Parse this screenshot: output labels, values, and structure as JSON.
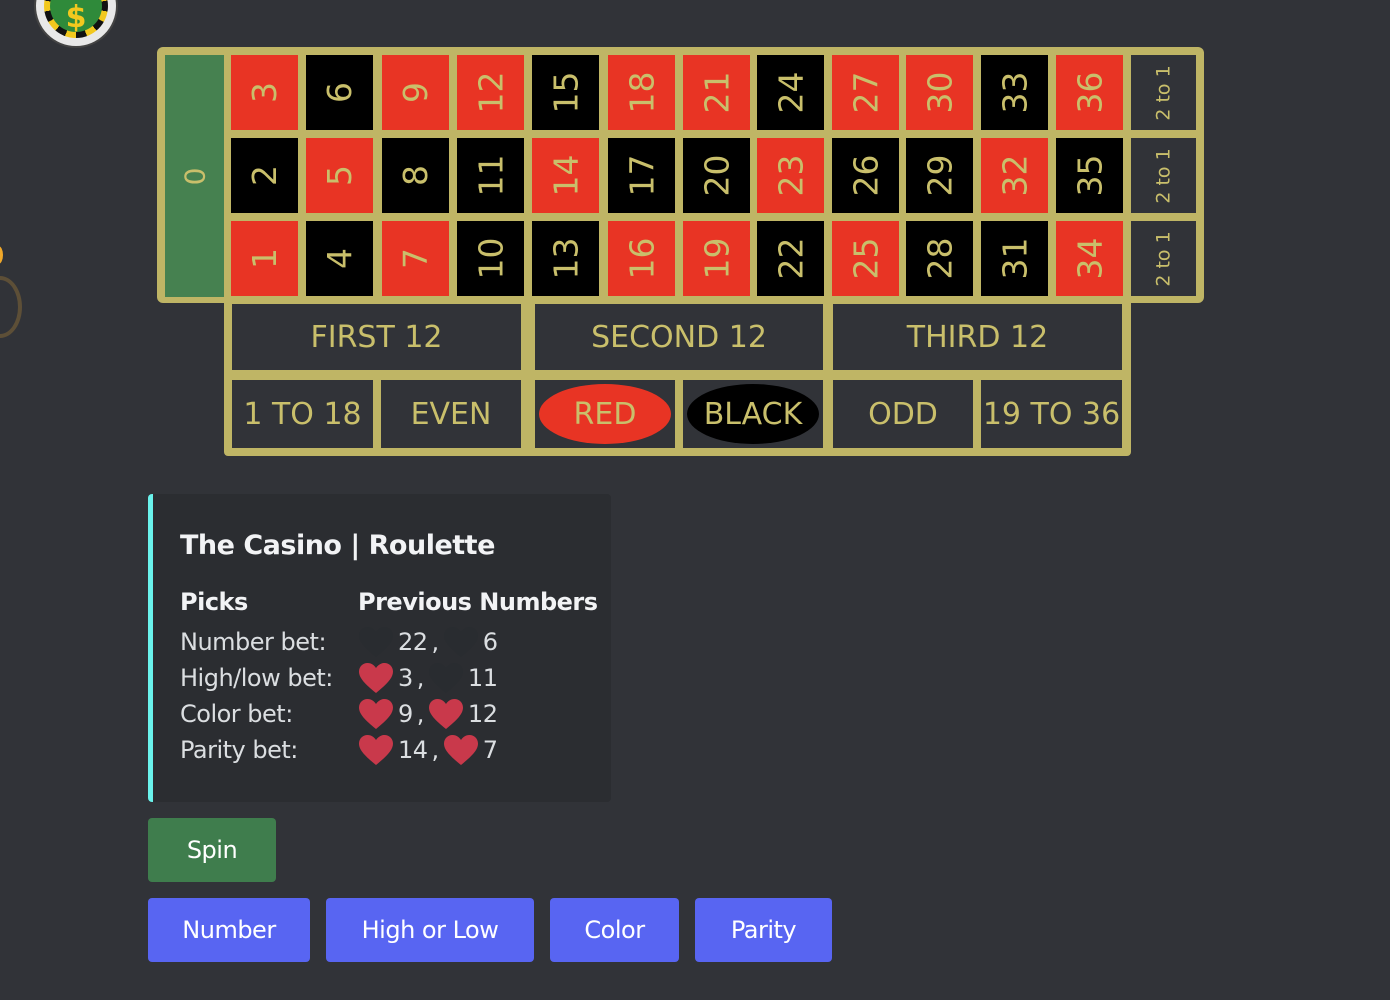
{
  "colors": {
    "red": "#e83424",
    "black": "#000000",
    "green": "#468150",
    "gold": "#bfb565",
    "embed_accent": "#6af3ec",
    "button_green": "#3f7d4d",
    "button_blurple": "#5865f2",
    "heart_red": "#c9394b",
    "heart_dark": "#292c30"
  },
  "icons": {
    "chip": "casino-chip-dollar-icon",
    "heart": "heart-icon"
  },
  "chip_symbol": "$",
  "board": {
    "zero": "0",
    "rows": [
      [
        {
          "n": "3",
          "color": "red"
        },
        {
          "n": "6",
          "color": "black"
        },
        {
          "n": "9",
          "color": "red"
        },
        {
          "n": "12",
          "color": "red"
        },
        {
          "n": "15",
          "color": "black"
        },
        {
          "n": "18",
          "color": "red"
        },
        {
          "n": "21",
          "color": "red"
        },
        {
          "n": "24",
          "color": "black"
        },
        {
          "n": "27",
          "color": "red"
        },
        {
          "n": "30",
          "color": "red"
        },
        {
          "n": "33",
          "color": "black"
        },
        {
          "n": "36",
          "color": "red"
        }
      ],
      [
        {
          "n": "2",
          "color": "black"
        },
        {
          "n": "5",
          "color": "red"
        },
        {
          "n": "8",
          "color": "black"
        },
        {
          "n": "11",
          "color": "black"
        },
        {
          "n": "14",
          "color": "red"
        },
        {
          "n": "17",
          "color": "black"
        },
        {
          "n": "20",
          "color": "black"
        },
        {
          "n": "23",
          "color": "red"
        },
        {
          "n": "26",
          "color": "black"
        },
        {
          "n": "29",
          "color": "black"
        },
        {
          "n": "32",
          "color": "red"
        },
        {
          "n": "35",
          "color": "black"
        }
      ],
      [
        {
          "n": "1",
          "color": "red"
        },
        {
          "n": "4",
          "color": "black"
        },
        {
          "n": "7",
          "color": "red"
        },
        {
          "n": "10",
          "color": "black"
        },
        {
          "n": "13",
          "color": "black"
        },
        {
          "n": "16",
          "color": "red"
        },
        {
          "n": "19",
          "color": "red"
        },
        {
          "n": "22",
          "color": "black"
        },
        {
          "n": "25",
          "color": "red"
        },
        {
          "n": "28",
          "color": "black"
        },
        {
          "n": "31",
          "color": "black"
        },
        {
          "n": "34",
          "color": "red"
        }
      ]
    ],
    "column_bets": [
      "2 to 1",
      "2 to 1",
      "2 to 1"
    ],
    "dozens": [
      "FIRST 12",
      "SECOND 12",
      "THIRD 12"
    ],
    "outside": [
      "1 TO 18",
      "EVEN",
      "RED",
      "BLACK",
      "ODD",
      "19 TO 36"
    ]
  },
  "embed": {
    "title": "The Casino | Roulette",
    "picks_header": "Picks",
    "previous_header": "Previous Numbers",
    "picks": [
      "Number bet:",
      "High/low bet:",
      "Color bet:",
      "Parity bet:"
    ],
    "previous": [
      [
        {
          "value": "22",
          "heart": "dark"
        },
        {
          "value": "6",
          "heart": "dark"
        }
      ],
      [
        {
          "value": "3",
          "heart": "red"
        },
        {
          "value": "11",
          "heart": "dark"
        }
      ],
      [
        {
          "value": "9",
          "heart": "red"
        },
        {
          "value": "12",
          "heart": "red"
        }
      ],
      [
        {
          "value": "14",
          "heart": "red"
        },
        {
          "value": "7",
          "heart": "red"
        }
      ]
    ],
    "separator": ","
  },
  "buttons": {
    "spin": "Spin",
    "number": "Number",
    "high_low": "High or Low",
    "color": "Color",
    "parity": "Parity"
  }
}
